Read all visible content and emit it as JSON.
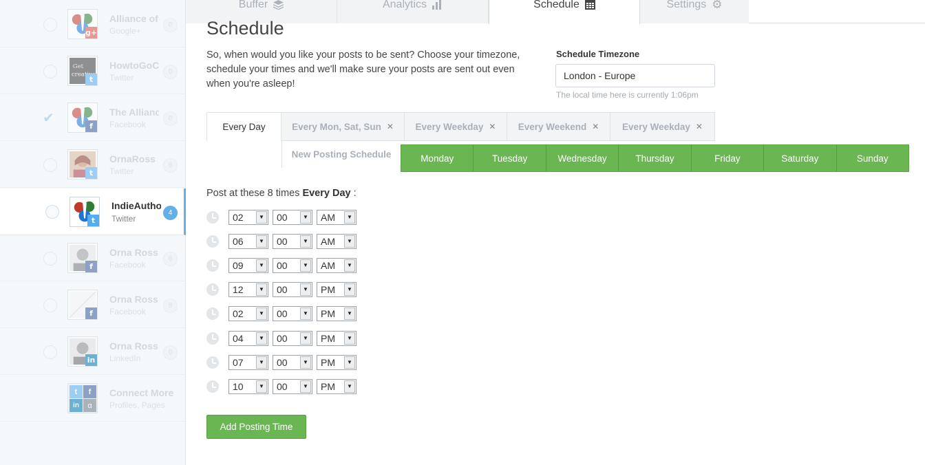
{
  "sidebar": {
    "profiles": [
      {
        "name": "Alliance of",
        "network": "Google+",
        "count": "0",
        "selected": false,
        "badge": "g+"
      },
      {
        "name": "HowtoGoCr",
        "network": "Twitter",
        "count": "0",
        "selected": false,
        "badge": "twitter"
      },
      {
        "name": "The Allianc",
        "network": "Facebook",
        "count": "0",
        "selected": true,
        "badge": "f"
      },
      {
        "name": "OrnaRoss",
        "network": "Twitter",
        "count": "6",
        "selected": false,
        "badge": "twitter"
      },
      {
        "name": "IndieAutho",
        "network": "Twitter",
        "count": "4",
        "selected": false,
        "badge": "twitter"
      },
      {
        "name": "Orna Ross",
        "network": "Facebook",
        "count": "6",
        "selected": false,
        "badge": "f"
      },
      {
        "name": "Orna Ross",
        "network": "Facebook",
        "count": "8",
        "selected": false,
        "badge": "f"
      },
      {
        "name": "Orna Ross",
        "network": "LinkedIn",
        "count": "0",
        "selected": false,
        "badge": "in"
      }
    ],
    "connect_more": {
      "title": "Connect More",
      "subtitle": "Profiles, Pages"
    }
  },
  "tabs": [
    {
      "label": "Buffer",
      "icon": "stack-icon"
    },
    {
      "label": "Analytics",
      "icon": "bar-chart-icon"
    },
    {
      "label": "Schedule",
      "icon": "calendar-grid-icon"
    },
    {
      "label": "Settings",
      "icon": "gear-icon"
    }
  ],
  "main": {
    "title": "Schedule",
    "intro": "So, when would you like your posts to be sent? Choose your timezone, schedule your times and we'll make sure your posts are sent out even when you're asleep!",
    "timezone_label": "Schedule Timezone",
    "timezone_value": "London - Europe",
    "timezone_note": "The local time here is currently 1:06pm",
    "schedule_tabs": [
      "Every Day",
      "Every Mon, Sat, Sun",
      "Every Weekday",
      "Every Weekend",
      "Every Weekday"
    ],
    "new_schedule": "New Posting Schedule",
    "days": [
      "Monday",
      "Tuesday",
      "Wednesday",
      "Thursday",
      "Friday",
      "Saturday",
      "Sunday"
    ],
    "post_at_prefix": "Post at these 8 times",
    "post_at_bold": "Every Day",
    "post_at_suffix": ":",
    "times": [
      {
        "hour": "02",
        "minute": "00",
        "ampm": "AM"
      },
      {
        "hour": "06",
        "minute": "00",
        "ampm": "AM"
      },
      {
        "hour": "09",
        "minute": "00",
        "ampm": "AM"
      },
      {
        "hour": "12",
        "minute": "00",
        "ampm": "PM"
      },
      {
        "hour": "02",
        "minute": "00",
        "ampm": "PM"
      },
      {
        "hour": "04",
        "minute": "00",
        "ampm": "PM"
      },
      {
        "hour": "07",
        "minute": "00",
        "ampm": "PM"
      },
      {
        "hour": "10",
        "minute": "00",
        "ampm": "PM"
      }
    ],
    "add_button": "Add Posting Time"
  },
  "colors": {
    "green": "#6ab653",
    "blue": "#63b0e8",
    "twitter": "#55acee",
    "facebook": "#3b5998",
    "google": "#dd4b39",
    "linkedin": "#0077b5"
  }
}
